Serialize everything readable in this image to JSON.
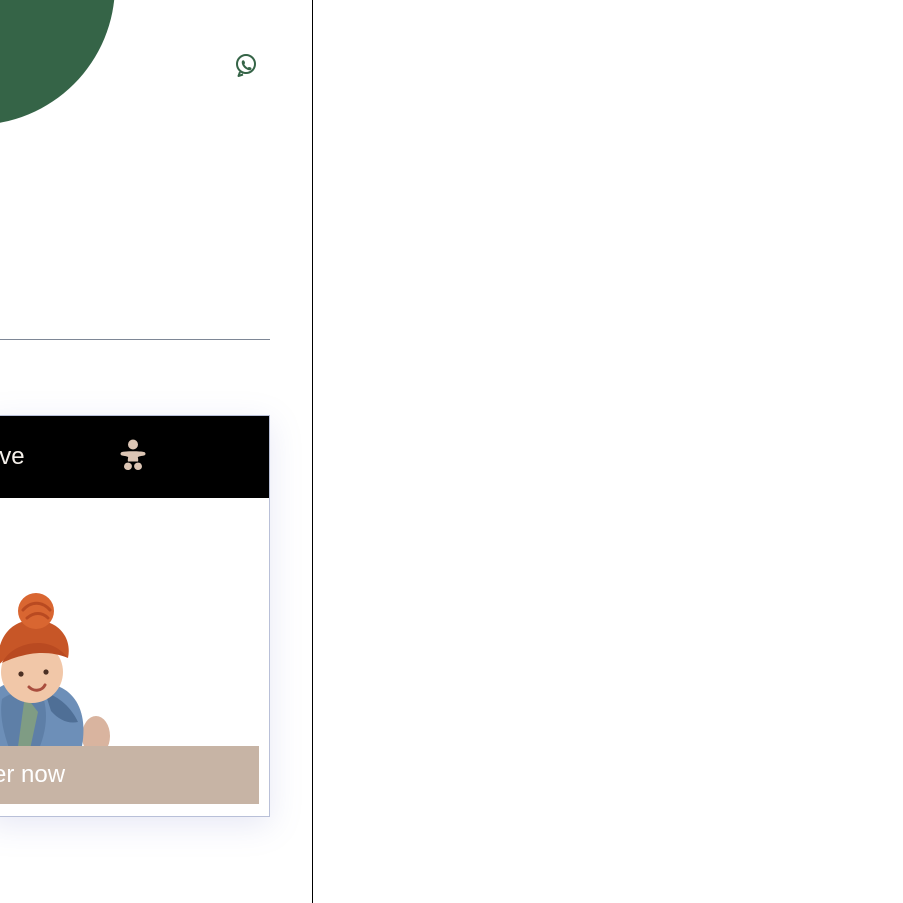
{
  "colors": {
    "brand_green": "#356447",
    "header_black": "#000000",
    "button_beige": "#c7b4a5",
    "hat_orange": "#c75627",
    "denim_blue": "#6d8fb8",
    "baby_icon_beige": "#dcc5b4"
  },
  "icons": {
    "whatsapp": "whatsapp-icon",
    "baby": "baby-icon"
  },
  "promo": {
    "title": "y’s Love",
    "button_label": "Order now",
    "image_alt": "baby-wearing-orange-turban-and-denim-jacket"
  }
}
